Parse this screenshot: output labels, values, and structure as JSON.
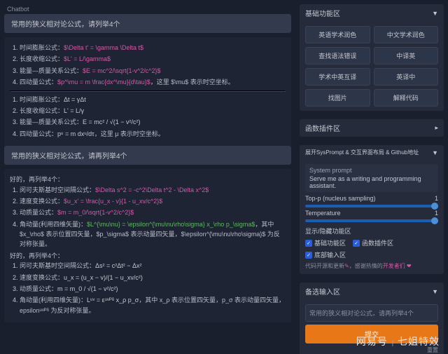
{
  "header": {
    "tab": "Chatbot"
  },
  "chat": {
    "q1": "常用的狭义相对论公式，请列举4个",
    "a1": {
      "items": [
        {
          "label": "时间膨胀公式：",
          "formula": "$\\Delta t' = \\gamma \\Delta t$"
        },
        {
          "label": "长度收缩公式：",
          "formula": "$L' = L/\\gamma$"
        },
        {
          "label": "能量—质量关系公式：",
          "formula": "$E = mc^2/\\sqrt{1-v^2/c^2}$"
        },
        {
          "label": "四动量公式：",
          "formula": "$p^\\mu = m \\frac{dx^\\mu}{d\\tau}$",
          "tail": "，这里 $\\mu$ 表示时空坐标。"
        }
      ],
      "rendered": [
        {
          "label": "时间膨胀公式：",
          "formula": "Δt = γΔt"
        },
        {
          "label": "长度收缩公式：",
          "formula": "L' = L/γ"
        },
        {
          "label": "能量—质量关系公式：",
          "formula": "E = mc² / √(1 − v²/c²)"
        },
        {
          "label": "四动量公式：",
          "formula": "pᵘ = m dxᵘ/dτ",
          "tail": "，这里 μ 表示时空坐标。"
        }
      ]
    },
    "q2": "常用的狭义相对论公式，请再列举4个",
    "a2": {
      "intro": "好的，再列举4个：",
      "items": [
        {
          "label": "闵可夫斯基时空间隔公式：",
          "formula": "$\\Delta s^2 = -c^2\\Delta t^2 - \\Delta x^2$"
        },
        {
          "label": "速度变换公式：",
          "formula": "$u_x' = \\frac{u_x - v}{1 - u_xv/c^2}$"
        },
        {
          "label": "动质量公式：",
          "formula": "$m = m_0/\\sqrt{1-v^2/c^2}$"
        },
        {
          "label": "角动量(利用四维矢量)：",
          "formula": "$L^{\\mu\\nu} = \\epsilon^{\\mu\\nu\\rho\\sigma} x_\\rho p_\\sigma$",
          "tail": "，其中 $x_\\rho$ 表示位置四矢量，$p_\\sigma$ 表示动量四矢量，$\\epsilon^{\\mu\\nu\\rho\\sigma}$ 为反对称张量。"
        }
      ],
      "intro2": "好的，再列举4个：",
      "rendered": [
        {
          "label": "闵可夫斯基时空间隔公式：",
          "formula": "Δs² = c²Δt² − Δx²"
        },
        {
          "label": "速度变换公式：",
          "formula": "u_x = (u_x − v)/(1 − u_xv/c²)"
        },
        {
          "label": "动质量公式：",
          "formula": "m = m_0 / √(1 − v²/c²)"
        },
        {
          "label": "角动量(利用四维矢量)：",
          "formula": "Lᵘᵛ = εᵘᵛᴾᵟ x_ρ p_σ",
          "tail": "，其中 x_ρ 表示位置四矢量，p_σ 表示动量四矢量，epsilonᵘᵛᴾᵟ 为反对称张量。"
        }
      ]
    }
  },
  "sidebar": {
    "basic": {
      "title": "基础功能区",
      "buttons": [
        "英语学术润色",
        "中文学术润色",
        "查找语法错误",
        "中译英",
        "学术中英互译",
        "英译中",
        "找图片",
        "解释代码"
      ]
    },
    "plugin": {
      "title": "函数插件区"
    },
    "settings": {
      "title": "展开SysPrompt & 交互界面布局 & Github地址",
      "sys_label": "System prompt",
      "sys_value": "Serve me as a writing and programming assistant.",
      "topp_label": "Top-p (nucleus sampling)",
      "topp_val": "1",
      "temp_label": "Temperature",
      "temp_val": "1",
      "checks_label": "显示/隐藏功能区",
      "check1": "基础功能区",
      "check2": "函数插件区",
      "check3": "底部输入区",
      "footnote_a": "代码开源和更新",
      "footnote_b": "，感谢热情的",
      "footnote_c": "开发者们 ❤"
    },
    "input": {
      "title": "备选输入区",
      "placeholder": "常用的狭义相对论公式，请再列举4个",
      "submit": "提交",
      "reset": "重置"
    }
  },
  "watermark": {
    "brand": "网易号",
    "sep": "|",
    "name": "七姐特效"
  }
}
